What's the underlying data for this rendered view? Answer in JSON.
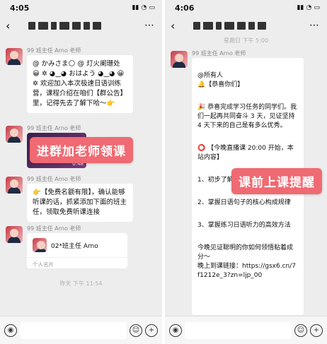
{
  "left": {
    "time": "4:05",
    "status_icons": "▮▮ ◔ ▭",
    "sender1": "99 班主任 Arno 老师",
    "msg1_line1": "@ かみさま🌕 @ 灯火阑珊处",
    "msg1_body": "😀 ✲ ◕‿◕ おはよう ◕‿◕ 😀✲ 欢迎加入本次极速日语训练营，课程介绍在咱们【群公告】里，记得先去了解下哈～👉",
    "sender2": "99 班主任 Arno 老师",
    "video_time": "0:48",
    "overlay1": "进群加老师领课",
    "sender3": "99 班主任 Arno 老师",
    "msg3": "👉【免费名额有限】，确认能够听课的话，抓紧添加下面的班主任，领取免费听课连接",
    "sender4": "99 班主任 Arno 老师",
    "card_name": "02*班主任 Arno",
    "card_foot": "个人名片",
    "timestamp": "昨天 下午 11:54"
  },
  "right": {
    "time": "4:06",
    "status_icons": "▮▮ ◔ ▭",
    "timestamp": "星期日 下午 5:00",
    "sender1": "99 班主任 Arno 老师",
    "msg_p1": "@所有人\n🔔【恭喜你们】",
    "msg_p2": "🎉 恭喜完成学习任务的同学们。我们一起再共同奋斗 3 天，见证坚持 4 天下来的自己是有多么优秀。",
    "msg_p3": "⭕ 【今晚直播课 20:00 开始，本站内容】",
    "msg_p4": "1、初步了解 ▒▒▒▒▒▒▒ 标志作用",
    "msg_p5": "2、掌握日语句子的核心构成规律",
    "msg_p6": "3、掌握练习日语听力的高效方法",
    "msg_p7": "今晚见证聪明的你如何领悟粘着成分～\n晚上到课链接：https://gsx6.cn/7f1212e_3?zn=ljp_00",
    "overlay2": "课前上课提醒"
  },
  "icons": {
    "back": "‹",
    "more": "⋯",
    "voice": "◉",
    "emoji": "☺",
    "plus": "+"
  }
}
